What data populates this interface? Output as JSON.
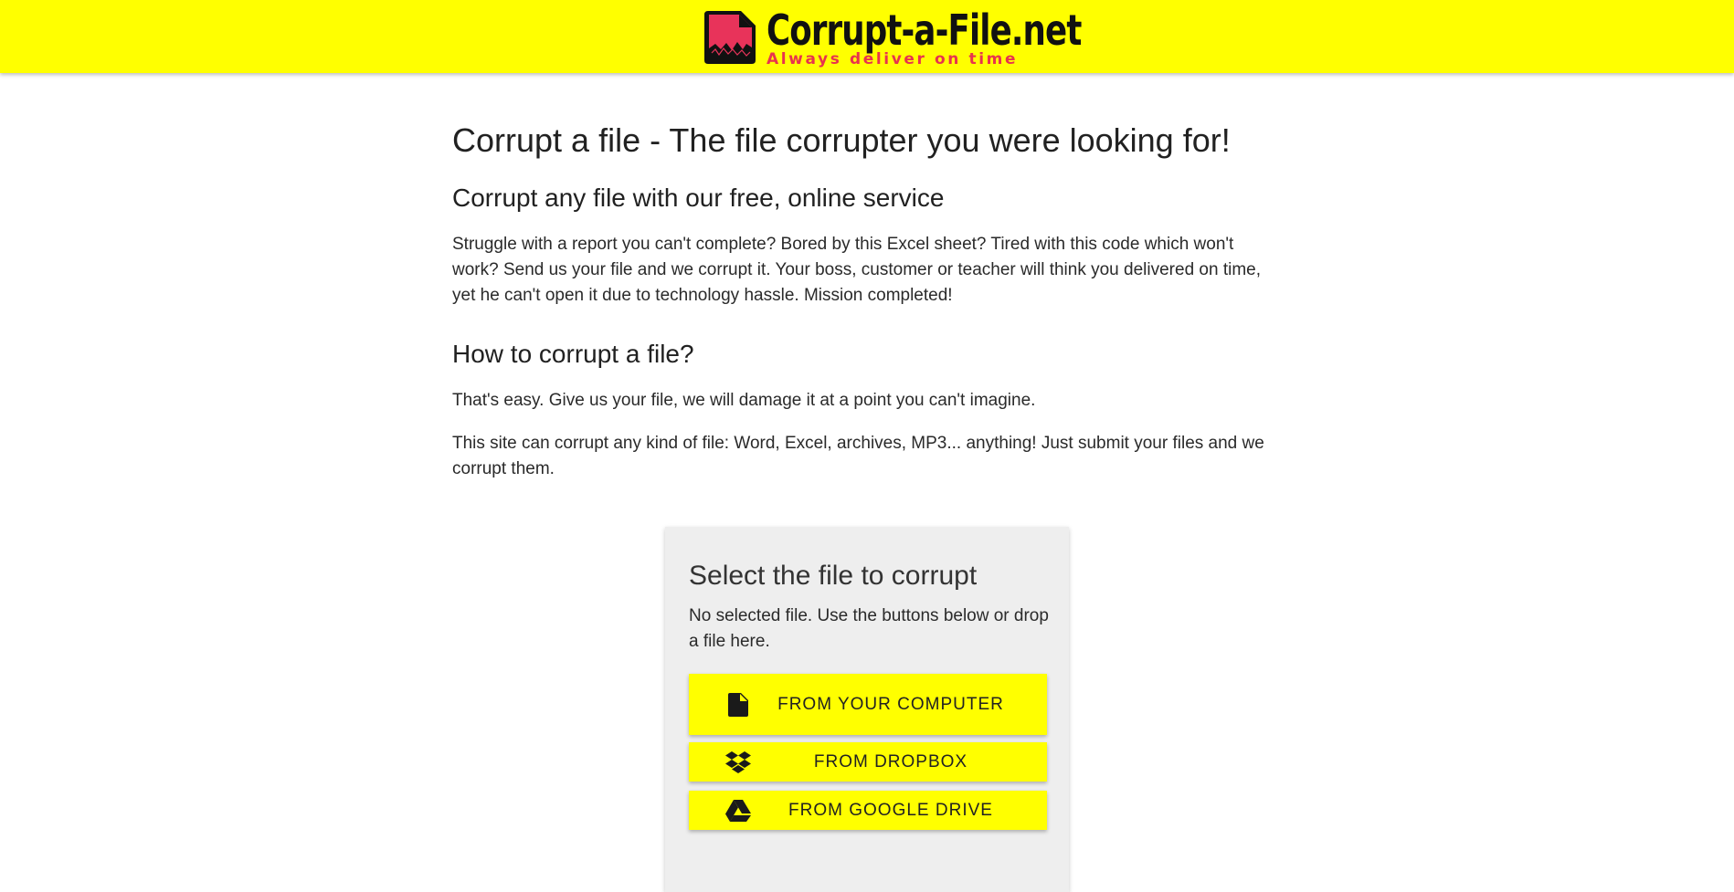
{
  "header": {
    "logo_title": "Corrupt-a-File.net",
    "logo_tagline": "Always deliver on time",
    "background_color": "#ffff00",
    "tagline_color": "#e8334e",
    "logo_icon": "corrupted-file-icon"
  },
  "main": {
    "title": "Corrupt a file - The file corrupter you were looking for!",
    "subtitle_1": "Corrupt any file with our free, online service",
    "paragraph_1": "Struggle with a report you can't complete? Bored by this Excel sheet? Tired with this code which won't work? Send us your file and we corrupt it. Your boss, customer or teacher will think you delivered on time, yet he can't open it due to technology hassle. Mission completed!",
    "subtitle_2": "How to corrupt a file?",
    "paragraph_2": "That's easy. Give us your file, we will damage it at a point you can't imagine.",
    "paragraph_3": "This site can corrupt any kind of file: Word, Excel, archives, MP3... anything! Just submit your files and we corrupt them."
  },
  "upload_card": {
    "title": "Select the file to corrupt",
    "description": "No selected file. Use the buttons below or drop a file here.",
    "buttons": [
      {
        "label": "FROM YOUR COMPUTER",
        "icon": "file-icon"
      },
      {
        "label": "FROM DROPBOX",
        "icon": "dropbox-icon"
      },
      {
        "label": "FROM GOOGLE DRIVE",
        "icon": "google-drive-icon"
      }
    ],
    "button_color": "#ffff00",
    "card_color": "#eeeeee"
  }
}
